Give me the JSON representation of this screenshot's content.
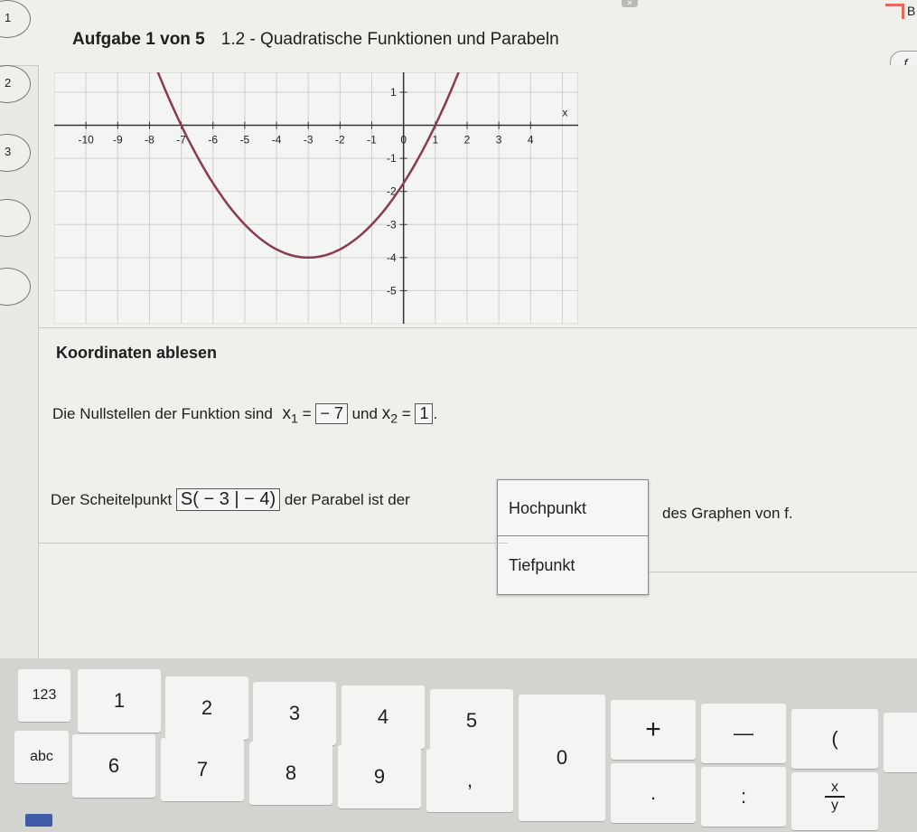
{
  "header": {
    "task_label": "Aufgabe 1 von 5",
    "topic": "1.2 - Quadratische Funktionen und Parabeln",
    "corner_letter": "B",
    "help_icon": "formula-icon"
  },
  "sidebar": {
    "items": [
      "1",
      "2",
      "3",
      "",
      ""
    ]
  },
  "chart_data": {
    "type": "line",
    "xlim": [
      -11,
      5.5
    ],
    "ylim": [
      -6,
      1.6
    ],
    "x_ticks": [
      -10,
      -9,
      -8,
      -7,
      -6,
      -5,
      -4,
      -3,
      -2,
      -1,
      0,
      1,
      2,
      3,
      4
    ],
    "x_tick_labels": [
      "-10",
      "-9",
      "-8",
      "-7",
      "-6",
      "-5",
      "-4",
      "-3",
      "-2",
      "-1",
      "0",
      "1",
      "2",
      "3",
      "4"
    ],
    "y_ticks": [
      1,
      -1,
      -2,
      -3,
      -4,
      -5
    ],
    "y_tick_labels": [
      "1",
      "-1",
      "-2",
      "-3",
      "-4",
      "-5"
    ],
    "x_axis_label": "x",
    "grid": true,
    "series": [
      {
        "function": "0.25*(x+3)^2-4",
        "x_range": [
          -8.2,
          2.2
        ],
        "color": "#8a3a4e"
      }
    ]
  },
  "section": {
    "title": "Koordinaten ablesen"
  },
  "question1": {
    "text_a": "Die Nullstellen der Funktion sind",
    "x1_label": "x",
    "x1_sub": "1",
    "eq": "=",
    "x1_value": "− 7",
    "und": "und",
    "x2_label": "x",
    "x2_sub": "2",
    "x2_value": "1",
    "period": "."
  },
  "question2": {
    "text_a": "Der Scheitelpunkt",
    "vertex": "S( − 3 | − 4)",
    "text_b": "der Parabel ist der",
    "options": [
      "Hochpunkt",
      "Tiefpunkt"
    ],
    "text_c": "des Graphen von f."
  },
  "keyboard": {
    "row1": [
      "123",
      "1",
      "2",
      "3",
      "4",
      "5"
    ],
    "row2": [
      "abc",
      "6",
      "7",
      "8",
      "9",
      ","
    ],
    "zero": "0",
    "plus": "+",
    "minus": "—",
    "paren": "(",
    "dot": ".",
    "colon": ":",
    "frac_top": "x",
    "frac_bottom": "y"
  }
}
